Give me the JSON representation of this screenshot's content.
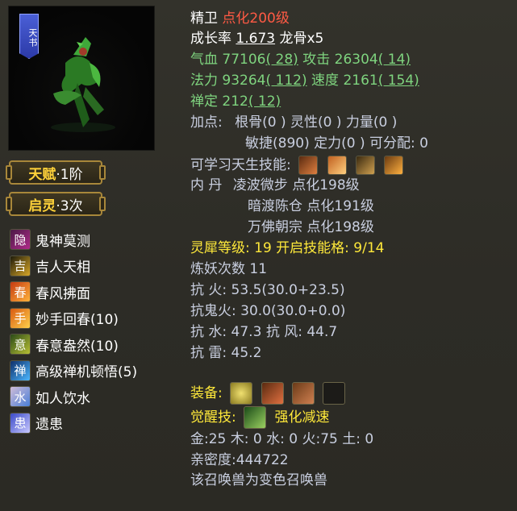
{
  "portrait": {
    "tag": "天书"
  },
  "badges": {
    "talent": {
      "label": "天赋",
      "value": "·1阶"
    },
    "spirit": {
      "label": "启灵",
      "value": "·3次"
    }
  },
  "skills": [
    {
      "name": "鬼神莫测",
      "icon": "ghost-icon",
      "glyph": "隐"
    },
    {
      "name": "吉人天相",
      "icon": "face-icon",
      "glyph": "吉"
    },
    {
      "name": "春风拂面",
      "icon": "wind-icon",
      "glyph": "春"
    },
    {
      "name": "妙手回春(10)",
      "icon": "hand-icon",
      "glyph": "手"
    },
    {
      "name": "春意盎然(10)",
      "icon": "spring-icon",
      "glyph": "意"
    },
    {
      "name": "高级禅机顿悟(5)",
      "icon": "zen-icon",
      "glyph": "禅"
    },
    {
      "name": "如人饮水",
      "icon": "water-icon",
      "glyph": "水"
    },
    {
      "name": "遗患",
      "icon": "heal-icon",
      "glyph": "患"
    }
  ],
  "pet": {
    "name": "精卫",
    "level": "点化200级",
    "growth_label": "成长率",
    "growth": "1.673",
    "bone": "龙骨x5"
  },
  "stats": {
    "hp_label": "气血",
    "hp": "77106",
    "hp_add": "( 28)",
    "atk_label": "攻击",
    "atk": "26304",
    "atk_add": "( 14)",
    "mp_label": "法力",
    "mp": "93264",
    "mp_add": "( 112)",
    "spd_label": "速度",
    "spd": "2161",
    "spd_add": "( 154)",
    "zen_label": "禅定",
    "zen": "212",
    "zen_add": "( 12)"
  },
  "points": {
    "label": "加点:",
    "line1": "根骨(0 ) 灵性(0 ) 力量(0 )",
    "line2": "敏捷(890) 定力(0 ) 可分配: 0"
  },
  "learnable_label": "可学习天生技能:",
  "inner_label": "内    丹",
  "inner": [
    "凌波微步 点化198级",
    "暗渡陈仓 点化191级",
    "万佛朝宗 点化198级"
  ],
  "rhino": "灵犀等级: 19 开启技能格: 9/14",
  "demon": "炼妖次数 11",
  "resist": {
    "fire_label": "抗    火:",
    "fire": "53.5(30.0+23.5)",
    "ghostfire_label": "抗鬼火:",
    "ghostfire": "30.0(30.0+0.0)",
    "water_label": "抗    水:",
    "water": "47.3",
    "wind_label": "抗    风:",
    "wind": "44.7",
    "thunder_label": "抗    雷:",
    "thunder": "45.2"
  },
  "equip_label": "装备:",
  "awaken_label": "觉醒技:",
  "awaken_skill": "强化减速",
  "elements": "金:25 木: 0 水: 0 火:75 土: 0",
  "intimacy": "亲密度:444722",
  "variant_note": "该召唤兽为变色召唤兽"
}
